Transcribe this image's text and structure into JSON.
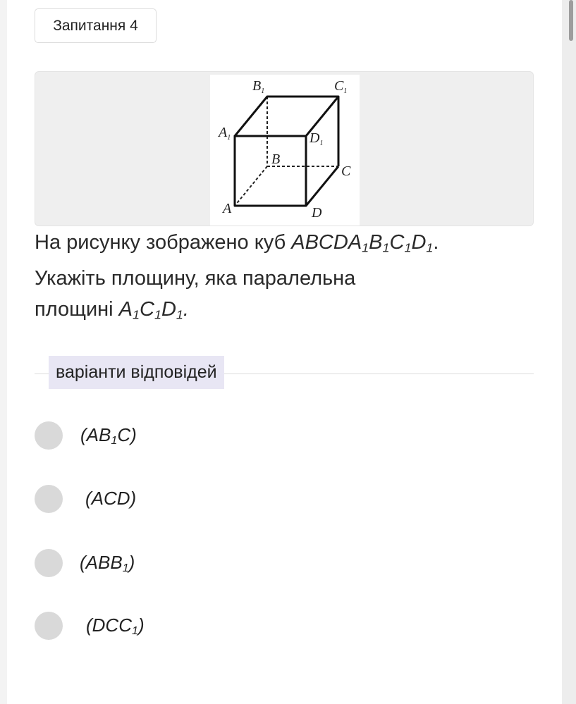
{
  "question": {
    "number_label": "Запитання 4",
    "text_intro": "На рисунку зображено куб ",
    "text_line2": "Укажіть площину, яка паралельна",
    "text_line3": "площині "
  },
  "figure": {
    "vertex_labels": {
      "B1": "B",
      "B1_sub": "1",
      "C1": "C",
      "C1_sub": "1",
      "A1": "A",
      "A1_sub": "1",
      "D1": "D",
      "D1_sub": "1",
      "B": "B",
      "C": "C",
      "A": "A",
      "D": "D"
    }
  },
  "answers": {
    "heading": "варіанти відповідей",
    "options": [
      {
        "pre": "(AB",
        "sub": "1",
        "post": "C)"
      },
      {
        "pre": "(ACD)",
        "sub": "",
        "post": ""
      },
      {
        "pre": "(ABB",
        "sub": "1",
        "post": ")"
      },
      {
        "pre": "(DCC",
        "sub": "1",
        "post": ")"
      }
    ]
  },
  "colors": {
    "heading_bg": "#e8e6f4",
    "radio": "#d9d9d9",
    "figure_bg": "#efefef"
  }
}
